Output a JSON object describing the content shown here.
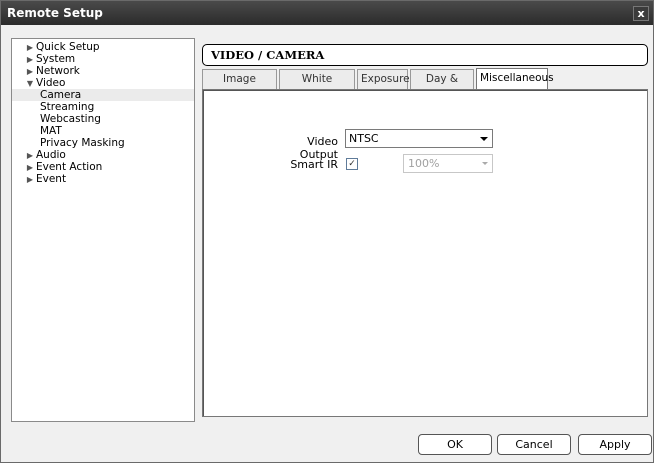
{
  "window": {
    "title": "Remote Setup",
    "close_glyph": "x"
  },
  "tree": {
    "items": [
      {
        "label": "Quick Setup",
        "arrow": "▶"
      },
      {
        "label": "System",
        "arrow": "▶"
      },
      {
        "label": "Network",
        "arrow": "▶"
      },
      {
        "label": "Video",
        "arrow": "▼"
      },
      {
        "label": "Camera",
        "child": true,
        "selected": true
      },
      {
        "label": "Streaming",
        "child": true
      },
      {
        "label": "Webcasting",
        "child": true
      },
      {
        "label": "MAT",
        "child": true
      },
      {
        "label": "Privacy Masking",
        "child": true
      },
      {
        "label": "Audio",
        "arrow": "▶"
      },
      {
        "label": "Event Action",
        "arrow": "▶"
      },
      {
        "label": "Event",
        "arrow": "▶"
      }
    ]
  },
  "section": {
    "title": "VIDEO / CAMERA"
  },
  "tabs": [
    {
      "label": "Image Sensor"
    },
    {
      "label": "White Balance"
    },
    {
      "label": "Exposure"
    },
    {
      "label": "Day & Night"
    },
    {
      "label": "Miscellaneous",
      "active": true
    }
  ],
  "form": {
    "video_output": {
      "label": "Video Output",
      "value": "NTSC"
    },
    "smart_ir": {
      "label": "Smart IR",
      "checked": true,
      "check_glyph": "✓",
      "level_value": "100%",
      "level_enabled": false
    }
  },
  "buttons": {
    "ok": "OK",
    "cancel": "Cancel",
    "apply": "Apply"
  }
}
